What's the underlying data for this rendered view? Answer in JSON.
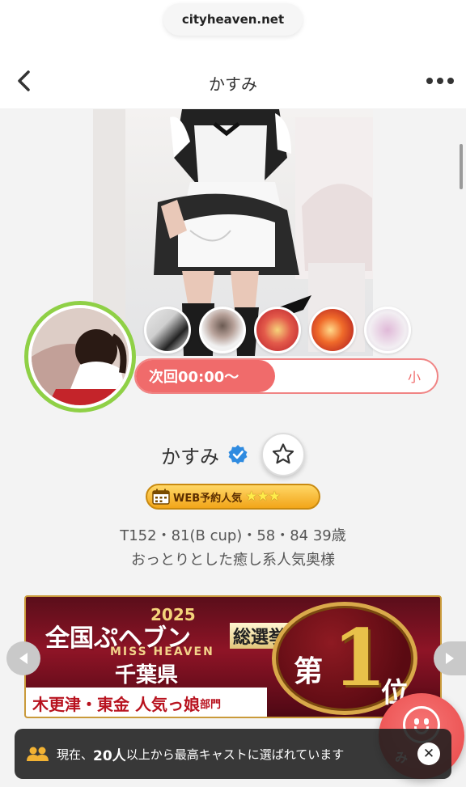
{
  "browser": {
    "url": "cityheaven.net"
  },
  "header": {
    "title": "かすみ"
  },
  "profile": {
    "next_schedule": "次回00:00〜",
    "next_right_label": "小",
    "name": "かすみ",
    "badge_label": "WEB予約人気",
    "badge_stars": "★★★",
    "stats": "T152・81(B cup)・58・84  39歳",
    "catchphrase": "おっとりとした癒し系人気奥様"
  },
  "banner": {
    "year": "2025",
    "title_main": "全国ぷヘブン",
    "title_tag": "総選挙",
    "subtitle": "MISS HEAVEN",
    "prefecture": "千葉県",
    "category": "木更津・東金 人気っ娘",
    "category_small": "部門",
    "rank_prefix": "第",
    "rank_number": "1",
    "rank_suffix": "位"
  },
  "toast": {
    "text_before": "現在、",
    "count": "20人",
    "text_after": "以上から最高キャストに選ばれています"
  },
  "fab": {
    "label": "み"
  },
  "colors": {
    "accent": "#f06b6b",
    "avatar_ring": "#8fd046",
    "verified": "#2f8be0",
    "badge": "#f2a519"
  },
  "icons": [
    "chevron-left-icon",
    "more-dots-icon",
    "verified-check-icon",
    "star-outline-icon",
    "calendar-icon",
    "people-icon",
    "close-icon",
    "smiley-icon"
  ]
}
